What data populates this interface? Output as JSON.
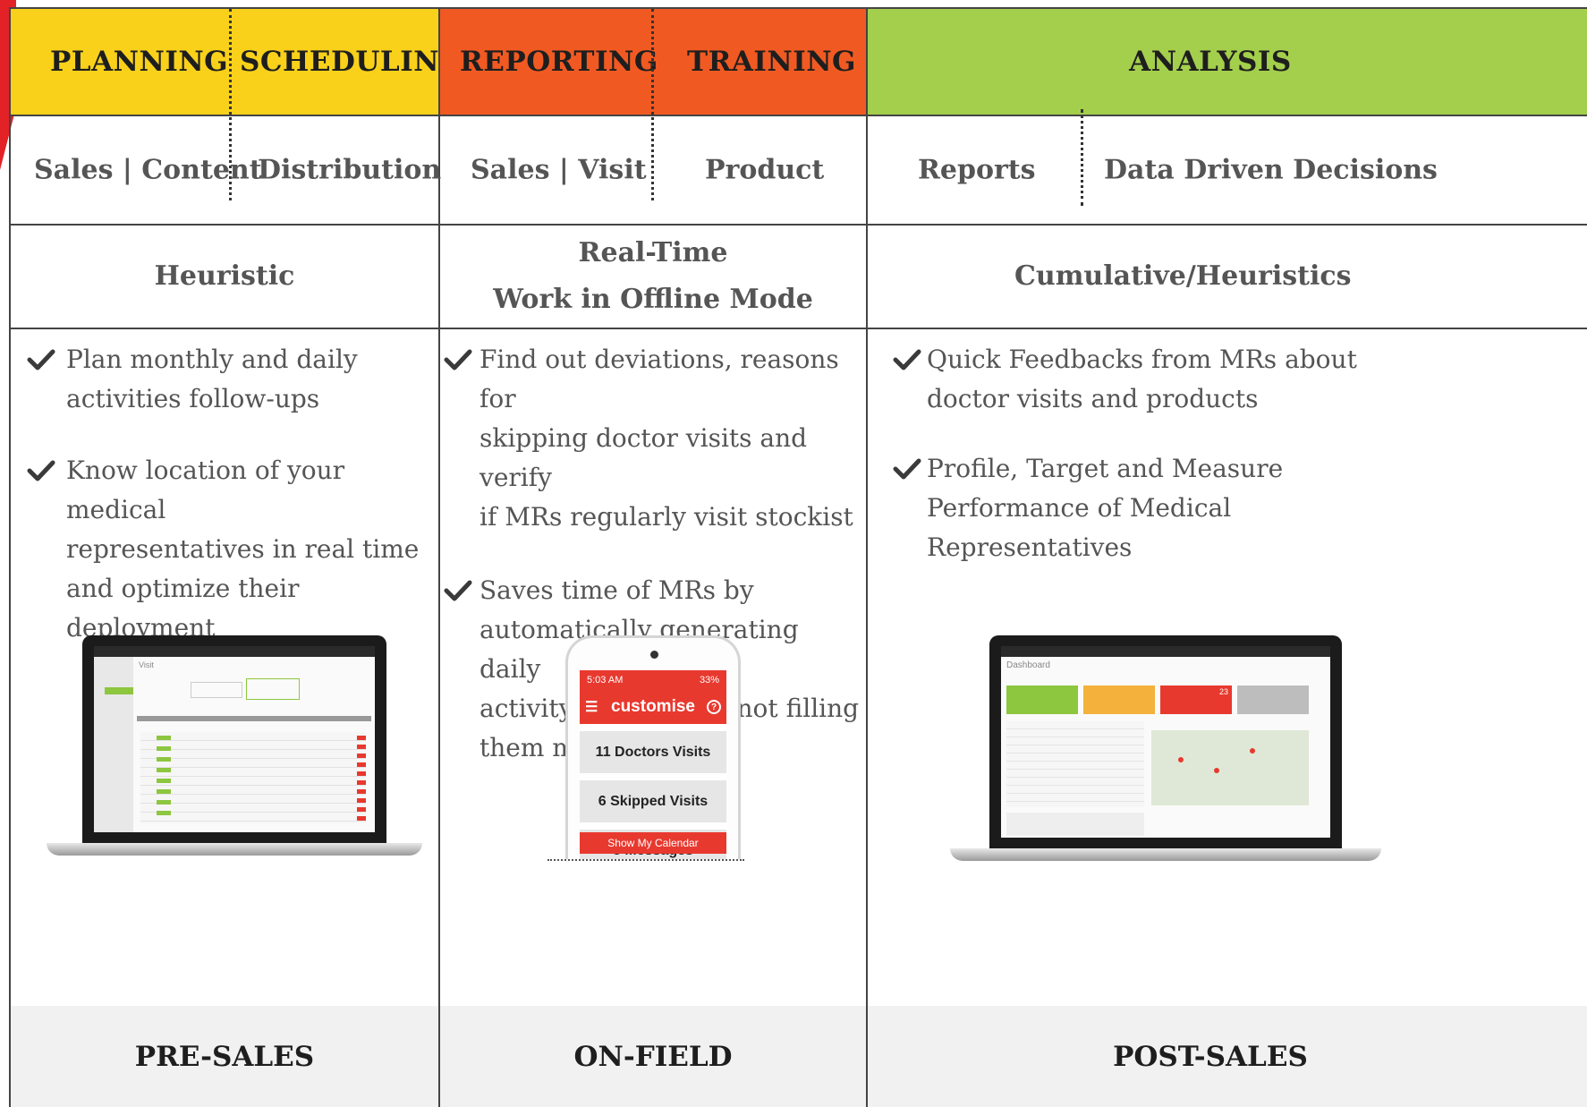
{
  "colors": {
    "planning": "#f9d11a",
    "reporting": "#f05a22",
    "analysis": "#a4cf4c",
    "footer": "#f1f1f2"
  },
  "pre_sales": {
    "headers": [
      "PLANNING",
      "SCHEDULING"
    ],
    "subheaders": [
      "Sales | Content",
      "Distribution"
    ],
    "mode": "Heuristic",
    "bullets": [
      [
        "Plan monthly and daily",
        "activities follow-ups"
      ],
      [
        "Know location of your medical",
        "representatives in real time",
        "and optimize their deployment"
      ]
    ],
    "footer": "PRE-SALES"
  },
  "on_field": {
    "headers": [
      "REPORTING",
      "TRAINING"
    ],
    "subheaders": [
      "Sales | Visit",
      "Product"
    ],
    "mode": [
      "Real-Time",
      "Work in Offline Mode"
    ],
    "bullets": [
      [
        "Find out deviations, reasons for",
        "skipping doctor visits and verify",
        "if MRs regularly visit stockist"
      ],
      [
        "Saves time of MRs by",
        "automatically generating daily",
        "activity reports and not filling",
        "them manually"
      ]
    ],
    "phone": {
      "time": "5:03 AM",
      "battery": "33%",
      "brand": "customise",
      "cards": [
        "11 Doctors Visits",
        "6 Skipped Visits",
        "5 Messages"
      ],
      "button": "Show My Calendar"
    },
    "footer": "ON-FIELD"
  },
  "post_sales": {
    "headers": [
      "ANALYSIS"
    ],
    "subheaders": [
      "Reports",
      "Data Driven Decisions"
    ],
    "mode": "Cumulative/Heuristics",
    "bullets": [
      [
        "Quick Feedbacks from MRs about",
        "doctor visits and products"
      ],
      [
        "Profile, Target and Measure",
        "Performance of  Medical",
        "Representatives"
      ]
    ],
    "laptop_screen": {
      "title": "Dashboard",
      "tile_value": "23"
    },
    "footer": "POST-SALES"
  },
  "presales_laptop_screen": {
    "title": "Visit"
  }
}
